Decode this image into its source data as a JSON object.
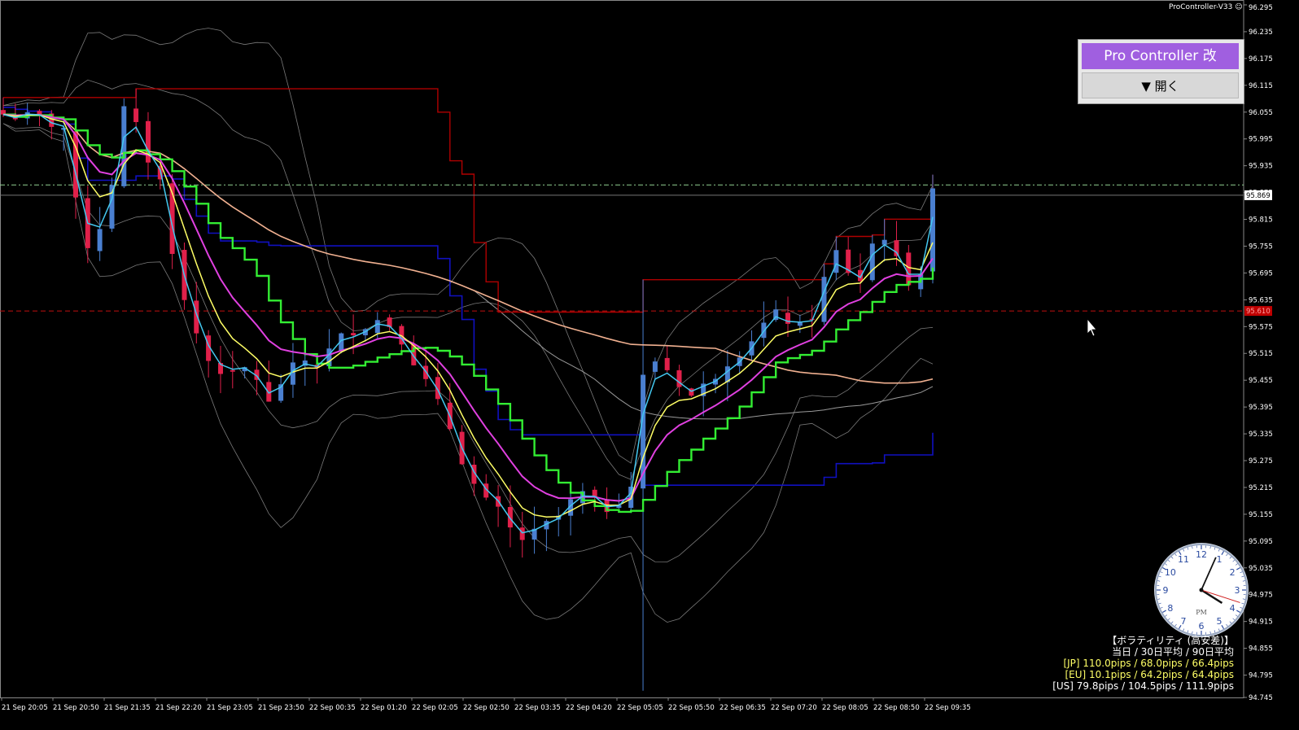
{
  "header": {
    "indicator_name": "ProController-V33"
  },
  "panel": {
    "title": "Pro Controller 改",
    "open_label": "▼ 開く"
  },
  "clock": {
    "period": "PM",
    "hour": 4,
    "minute": 4,
    "second": 18
  },
  "volatility": {
    "title": "【ボラティリティ (高安差)】",
    "columns": "当日 / 30日平均 / 90日平均",
    "rows": [
      {
        "text": "[JP] 110.0pips / 68.0pips / 66.4pips",
        "color": "#ffff66"
      },
      {
        "text": "[EU] 10.1pips / 64.2pips / 64.4pips",
        "color": "#ffff66"
      },
      {
        "text": "[US] 79.8pips / 104.5pips / 111.9pips",
        "color": "#ffffff"
      }
    ]
  },
  "colors": {
    "background": "#000000",
    "bull": "#4a7fd0",
    "bear": "#e0204a",
    "ma_fast": "#44c8f0",
    "ma_yellow": "#ffff66",
    "ma_magenta": "#e040e0",
    "ma_green": "#33ee33",
    "ma_salmon": "#f0b090",
    "bands": "#7a7a7a",
    "step_blue": "#1010c0",
    "step_red": "#b00000",
    "price_label": "#c00000"
  },
  "chart_data": {
    "type": "candlestick",
    "ylim": [
      94.745,
      96.295
    ],
    "yticks": [
      "96.295",
      "96.235",
      "96.175",
      "96.115",
      "96.055",
      "95.995",
      "95.935",
      "95.875",
      "95.815",
      "95.755",
      "95.695",
      "95.635",
      "95.575",
      "95.515",
      "95.455",
      "95.395",
      "95.335",
      "95.275",
      "95.215",
      "95.155",
      "95.095",
      "95.035",
      "94.975",
      "94.915",
      "94.855",
      "94.795",
      "94.745"
    ],
    "xticks": [
      "21 Sep 20:05",
      "21 Sep 20:50",
      "21 Sep 21:35",
      "21 Sep 22:20",
      "21 Sep 23:05",
      "21 Sep 23:50",
      "22 Sep 00:35",
      "22 Sep 01:20",
      "22 Sep 02:05",
      "22 Sep 02:50",
      "22 Sep 03:35",
      "22 Sep 04:20",
      "22 Sep 05:05",
      "22 Sep 05:50",
      "22 Sep 06:35",
      "22 Sep 07:20",
      "22 Sep 08:05",
      "22 Sep 08:50",
      "22 Sep 09:35"
    ],
    "current_price": "95.869",
    "level_red_dashed": "95.610",
    "level_green_dashdot": 95.892,
    "close_path": [
      [
        0,
        96.05
      ],
      [
        3,
        96.04
      ],
      [
        5,
        96.02
      ],
      [
        6,
        95.85
      ],
      [
        7,
        95.76
      ],
      [
        8,
        95.8
      ],
      [
        9,
        95.9
      ],
      [
        10,
        96.06
      ],
      [
        11,
        96.02
      ],
      [
        12,
        95.95
      ],
      [
        13,
        95.9
      ],
      [
        14,
        95.75
      ],
      [
        15,
        95.63
      ],
      [
        16,
        95.56
      ],
      [
        17,
        95.5
      ],
      [
        18,
        95.48
      ],
      [
        19,
        95.46
      ],
      [
        20,
        95.48
      ],
      [
        21,
        95.46
      ],
      [
        22,
        95.4
      ],
      [
        23,
        95.45
      ],
      [
        24,
        95.48
      ],
      [
        25,
        95.5
      ],
      [
        26,
        95.49
      ],
      [
        27,
        95.52
      ],
      [
        28,
        95.55
      ],
      [
        29,
        95.57
      ],
      [
        30,
        95.58
      ],
      [
        31,
        95.59
      ],
      [
        32,
        95.58
      ],
      [
        33,
        95.55
      ],
      [
        34,
        95.5
      ],
      [
        35,
        95.45
      ],
      [
        36,
        95.4
      ],
      [
        37,
        95.35
      ],
      [
        38,
        95.28
      ],
      [
        39,
        95.22
      ],
      [
        40,
        95.18
      ],
      [
        41,
        95.16
      ],
      [
        42,
        95.12
      ],
      [
        43,
        95.1
      ],
      [
        44,
        95.11
      ],
      [
        45,
        95.13
      ],
      [
        46,
        95.15
      ],
      [
        47,
        95.18
      ],
      [
        48,
        95.2
      ],
      [
        49,
        95.18
      ],
      [
        50,
        95.17
      ],
      [
        51,
        95.19
      ],
      [
        52,
        95.22
      ],
      [
        53,
        95.46
      ],
      [
        54,
        95.5
      ],
      [
        55,
        95.48
      ],
      [
        56,
        95.45
      ],
      [
        57,
        95.42
      ],
      [
        58,
        95.44
      ],
      [
        59,
        95.47
      ],
      [
        60,
        95.5
      ],
      [
        61,
        95.52
      ],
      [
        62,
        95.55
      ],
      [
        63,
        95.58
      ],
      [
        64,
        95.6
      ],
      [
        65,
        95.59
      ],
      [
        66,
        95.57
      ],
      [
        67,
        95.6
      ],
      [
        68,
        95.68
      ],
      [
        69,
        95.74
      ],
      [
        70,
        95.7
      ],
      [
        71,
        95.68
      ],
      [
        72,
        95.76
      ],
      [
        73,
        95.78
      ],
      [
        74,
        95.72
      ],
      [
        75,
        95.68
      ],
      [
        76,
        95.7
      ],
      [
        77,
        95.87
      ]
    ]
  }
}
